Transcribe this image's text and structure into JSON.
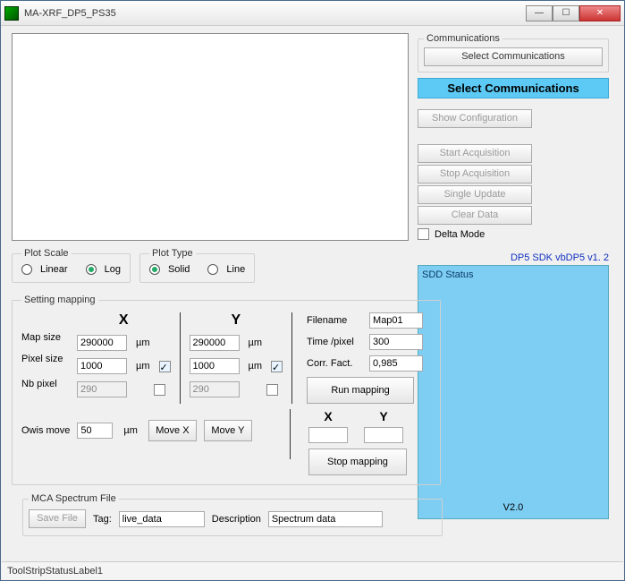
{
  "window": {
    "title": "MA-XRF_DP5_PS35"
  },
  "comm": {
    "legend": "Communications",
    "select_btn": "Select Communications",
    "highlight": "Select Communications",
    "show_config": "Show Configuration",
    "start_acq": "Start Acquisition",
    "stop_acq": "Stop Acquisition",
    "single_update": "Single Update",
    "clear_data": "Clear Data",
    "delta_mode": "Delta Mode"
  },
  "plot_scale": {
    "legend": "Plot Scale",
    "linear": "Linear",
    "log": "Log",
    "selected": "log"
  },
  "plot_type": {
    "legend": "Plot Type",
    "solid": "Solid",
    "line": "Line",
    "selected": "solid"
  },
  "mapping": {
    "legend": "Setting mapping",
    "x_label": "X",
    "y_label": "Y",
    "map_size_label": "Map size",
    "map_size_x": "290000",
    "map_size_y": "290000",
    "pixel_size_label": "Pixel size",
    "pixel_size_x": "1000",
    "pixel_size_y": "1000",
    "nb_pixel_label": "Nb pixel",
    "nb_pixel_x": "290",
    "nb_pixel_y": "290",
    "unit": "µm",
    "owis_label": "Owis move",
    "owis_val": "50",
    "move_x": "Move X",
    "move_y": "Move Y",
    "filename_label": "Filename",
    "filename": "Map01",
    "time_label": "Time /pixel",
    "time": "300",
    "corr_label": "Corr. Fact.",
    "corr": "0,985",
    "run": "Run mapping",
    "stop": "Stop mapping",
    "pos_x_label": "X",
    "pos_y_label": "Y",
    "pos_x": "",
    "pos_y": ""
  },
  "mca": {
    "legend": "MCA Spectrum File",
    "save": "Save File",
    "tag_label": "Tag:",
    "tag": "live_data",
    "desc_label": "Description",
    "desc": "Spectrum data"
  },
  "sdk": {
    "label": "DP5 SDK vbDP5 v1. 2"
  },
  "sdd": {
    "legend": "SDD Status",
    "version": "V2.0"
  },
  "status": "ToolStripStatusLabel1"
}
